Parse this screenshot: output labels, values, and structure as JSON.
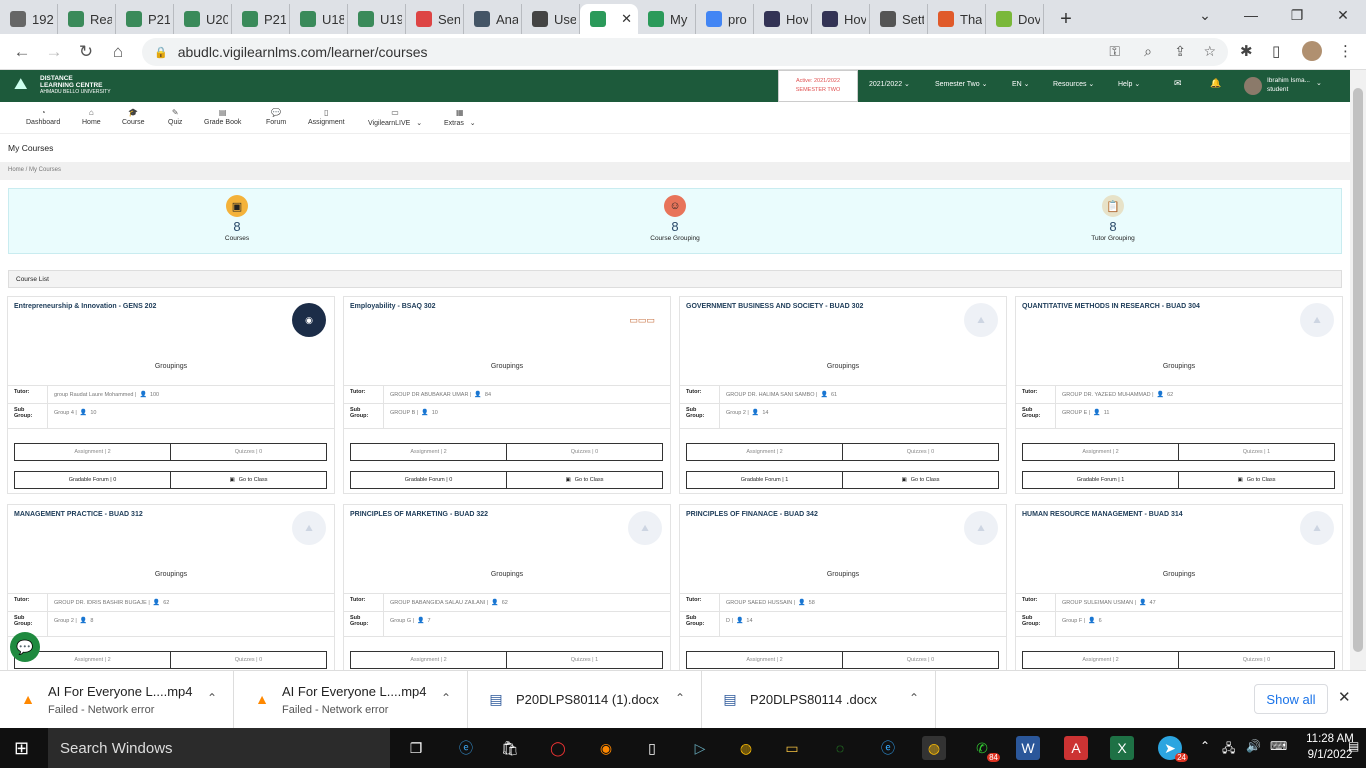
{
  "browser": {
    "tabs": [
      {
        "label": "192",
        "icon": "chrome-icon",
        "color": "#666"
      },
      {
        "label": "Rea",
        "icon": "lms-icon",
        "color": "#3a8a5a"
      },
      {
        "label": "P21",
        "icon": "lms-icon",
        "color": "#3a8a5a"
      },
      {
        "label": "U20",
        "icon": "lms-icon",
        "color": "#3a8a5a"
      },
      {
        "label": "P21",
        "icon": "lms-icon",
        "color": "#3a8a5a"
      },
      {
        "label": "U18",
        "icon": "lms-icon",
        "color": "#3a8a5a"
      },
      {
        "label": "U19",
        "icon": "lms-icon",
        "color": "#3a8a5a"
      },
      {
        "label": "Sen",
        "icon": "gmail-icon",
        "color": "#d44"
      },
      {
        "label": "Ana",
        "icon": "doc-icon",
        "color": "#456"
      },
      {
        "label": "Use",
        "icon": "globe-icon",
        "color": "#444"
      },
      {
        "label": "",
        "icon": "vigilearn-icon",
        "color": "#2b9a5a",
        "active": true
      },
      {
        "label": "My",
        "icon": "vigilearn-icon",
        "color": "#2b9a5a"
      },
      {
        "label": "pro",
        "icon": "google-icon",
        "color": "#4285f4"
      },
      {
        "label": "Hov",
        "icon": "edge-icon",
        "color": "#335"
      },
      {
        "label": "Hov",
        "icon": "edge-icon",
        "color": "#335"
      },
      {
        "label": "Sett",
        "icon": "gear-icon",
        "color": "#555"
      },
      {
        "label": "Tha",
        "icon": "brave-icon",
        "color": "#e05a2a"
      },
      {
        "label": "Dov",
        "icon": "download-icon",
        "color": "#7ab83a"
      }
    ],
    "url": "abudlc.vigilearnlms.com/learner/courses"
  },
  "site": {
    "logo_line1": "DISTANCE",
    "logo_line2": "LEARNING CENTRE",
    "logo_line3": "AHMADU BELLO UNIVERSITY",
    "active_label": "Active: 2021/2022",
    "semester_label": "SEMESTER TWO",
    "session": "2021/2022",
    "semester": "Semester Two",
    "lang": "EN",
    "resources": "Resources",
    "help": "Help",
    "user_name": "Ibrahim Isma...",
    "user_role": "student"
  },
  "nav": {
    "items": [
      {
        "label": "Dashboard",
        "icon": "dashboard-icon"
      },
      {
        "label": "Home",
        "icon": "home-icon"
      },
      {
        "label": "Course",
        "icon": "course-icon"
      },
      {
        "label": "Quiz",
        "icon": "quiz-icon"
      },
      {
        "label": "Grade Book",
        "icon": "gradebook-icon"
      },
      {
        "label": "Forum",
        "icon": "forum-icon"
      },
      {
        "label": "Assignment",
        "icon": "assignment-icon"
      },
      {
        "label": "VigilearnLIVE",
        "icon": "live-icon"
      },
      {
        "label": "Extras",
        "icon": "extras-icon"
      }
    ]
  },
  "page": {
    "title": "My Courses",
    "breadcrumb": "Home  /  My Courses",
    "course_list_label": "Course List"
  },
  "stats": [
    {
      "value": "8",
      "label": "Courses",
      "icon": "courses-icon",
      "color": "#f4b23a"
    },
    {
      "value": "8",
      "label": "Course Grouping",
      "icon": "group-icon",
      "color": "#e8745a"
    },
    {
      "value": "8",
      "label": "Tutor Grouping",
      "icon": "clipboard-icon",
      "color": "#e7e2c8"
    }
  ],
  "courses": [
    {
      "title": "Entrepreneurship & Innovation - GENS 202",
      "groupings": "Groupings",
      "tutor_label": "Tutor:",
      "tutor": "group Raudat Laure Mohammed |",
      "tutor_count": "100",
      "sub_label": "Sub Group:",
      "sub": "Group 4 |",
      "sub_count": "10",
      "assignment": "Assignment | 2",
      "quizzes": "Quizzes | 0",
      "forum": "Gradable Forum | 0",
      "goto": "Go to Class"
    },
    {
      "title": "Employability - BSAQ 302",
      "groupings": "Groupings",
      "tutor_label": "Tutor:",
      "tutor": "GROUP DR ABUBAKAR UMAR |",
      "tutor_count": "84",
      "sub_label": "Sub Group:",
      "sub": "GROUP B |",
      "sub_count": "10",
      "assignment": "Assignment | 2",
      "quizzes": "Quizzes | 0",
      "forum": "Gradable Forum | 0",
      "goto": "Go to Class"
    },
    {
      "title": "GOVERNMENT BUSINESS AND SOCIETY - BUAD 302",
      "groupings": "Groupings",
      "tutor_label": "Tutor:",
      "tutor": "GROUP DR. HALIMA SANI SAMBO |",
      "tutor_count": "61",
      "sub_label": "Sub Group:",
      "sub": "Group 2 |",
      "sub_count": "14",
      "assignment": "Assignment | 2",
      "quizzes": "Quizzes | 0",
      "forum": "Gradable Forum | 1",
      "goto": "Go to Class"
    },
    {
      "title": "QUANTITATIVE METHODS IN RESEARCH - BUAD 304",
      "groupings": "Groupings",
      "tutor_label": "Tutor:",
      "tutor": "GROUP DR. YAZEED MUHAMMAD |",
      "tutor_count": "62",
      "sub_label": "Sub Group:",
      "sub": "GROUP E |",
      "sub_count": "11",
      "assignment": "Assignment | 2",
      "quizzes": "Quizzes | 1",
      "forum": "Gradable Forum | 1",
      "goto": "Go to Class"
    },
    {
      "title": "MANAGEMENT PRACTICE - BUAD 312",
      "groupings": "Groupings",
      "tutor_label": "Tutor:",
      "tutor": "GROUP DR. IDRIS BASHIR BUGAJE |",
      "tutor_count": "62",
      "sub_label": "Sub Group:",
      "sub": "Group 2 |",
      "sub_count": "8",
      "assignment": "Assignment | 2",
      "quizzes": "Quizzes | 0"
    },
    {
      "title": "PRINCIPLES OF MARKETING - BUAD 322",
      "groupings": "Groupings",
      "tutor_label": "Tutor:",
      "tutor": "GROUP BABANGIDA SALAU ZAILANI |",
      "tutor_count": "62",
      "sub_label": "Sub Group:",
      "sub": "Group G |",
      "sub_count": "7",
      "assignment": "Assignment | 2",
      "quizzes": "Quizzes | 1"
    },
    {
      "title": "PRINCIPLES OF FINANACE - BUAD 342",
      "groupings": "Groupings",
      "tutor_label": "Tutor:",
      "tutor": "GROUP SAEED HUSSAIN |",
      "tutor_count": "58",
      "sub_label": "Sub Group:",
      "sub": "D |",
      "sub_count": "14",
      "assignment": "Assignment | 2",
      "quizzes": "Quizzes | 0"
    },
    {
      "title": "HUMAN RESOURCE MANAGEMENT - BUAD 314",
      "groupings": "Groupings",
      "tutor_label": "Tutor:",
      "tutor": "GROUP SULEIMAN USMAN |",
      "tutor_count": "47",
      "sub_label": "Sub Group:",
      "sub": "Group F |",
      "sub_count": "6",
      "assignment": "Assignment | 2",
      "quizzes": "Quizzes | 0"
    }
  ],
  "downloads": [
    {
      "name": "AI For Everyone L....mp4",
      "status": "Failed - Network error",
      "icon": "vlc-icon"
    },
    {
      "name": "AI For Everyone L....mp4",
      "status": "Failed - Network error",
      "icon": "vlc-icon"
    },
    {
      "name": "P20DLPS80114 (1).docx",
      "status": "",
      "icon": "word-icon"
    },
    {
      "name": "P20DLPS80114 .docx",
      "status": "",
      "icon": "word-icon"
    }
  ],
  "shelf": {
    "show_all": "Show all"
  },
  "taskbar": {
    "search": "Search Windows",
    "time": "11:28 AM",
    "date": "9/1/2022",
    "whatsapp_badge": "84",
    "telegram_badge": "24"
  },
  "colors": {
    "header": "#1d5a3b",
    "accent": "#1c3b58"
  }
}
